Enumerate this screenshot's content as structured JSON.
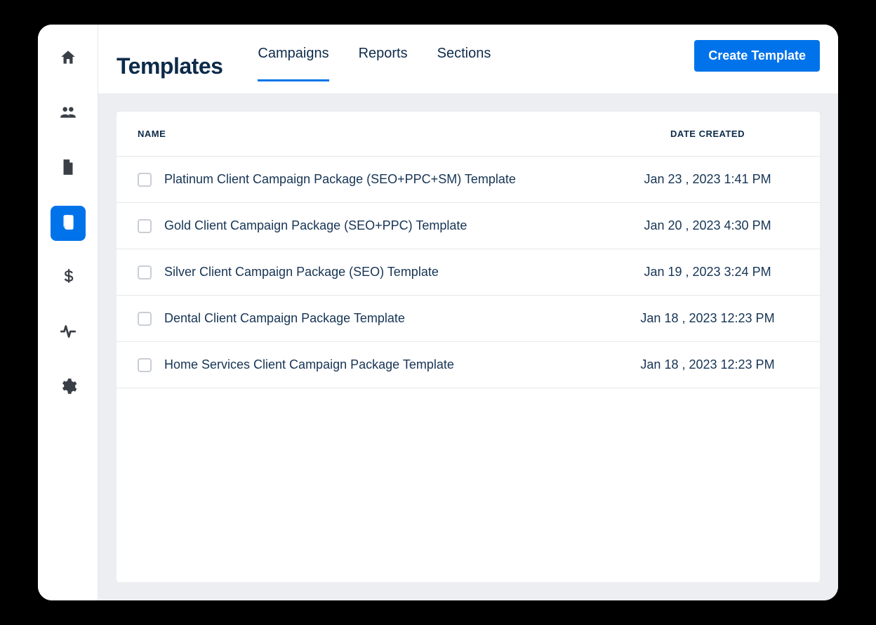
{
  "header": {
    "title": "Templates",
    "create_button_label": "Create Template"
  },
  "tabs": [
    {
      "label": "Campaigns",
      "active": true
    },
    {
      "label": "Reports",
      "active": false
    },
    {
      "label": "Sections",
      "active": false
    }
  ],
  "sidebar": {
    "items": [
      {
        "icon": "home",
        "active": false
      },
      {
        "icon": "users",
        "active": false
      },
      {
        "icon": "report",
        "active": false
      },
      {
        "icon": "templates",
        "active": true
      },
      {
        "icon": "billing",
        "active": false
      },
      {
        "icon": "activity",
        "active": false
      },
      {
        "icon": "settings",
        "active": false
      }
    ]
  },
  "table": {
    "columns": {
      "name": "NAME",
      "date": "DATE CREATED"
    },
    "rows": [
      {
        "name": "Platinum Client Campaign Package (SEO+PPC+SM) Template",
        "date": "Jan 23 , 2023 1:41 PM"
      },
      {
        "name": "Gold Client Campaign Package (SEO+PPC) Template",
        "date": "Jan 20 , 2023 4:30 PM"
      },
      {
        "name": "Silver Client Campaign Package (SEO) Template",
        "date": "Jan 19 , 2023 3:24 PM"
      },
      {
        "name": "Dental Client Campaign Package Template",
        "date": "Jan 18 , 2023 12:23 PM"
      },
      {
        "name": "Home Services Client Campaign Package Template",
        "date": "Jan 18 , 2023 12:23 PM"
      }
    ]
  }
}
